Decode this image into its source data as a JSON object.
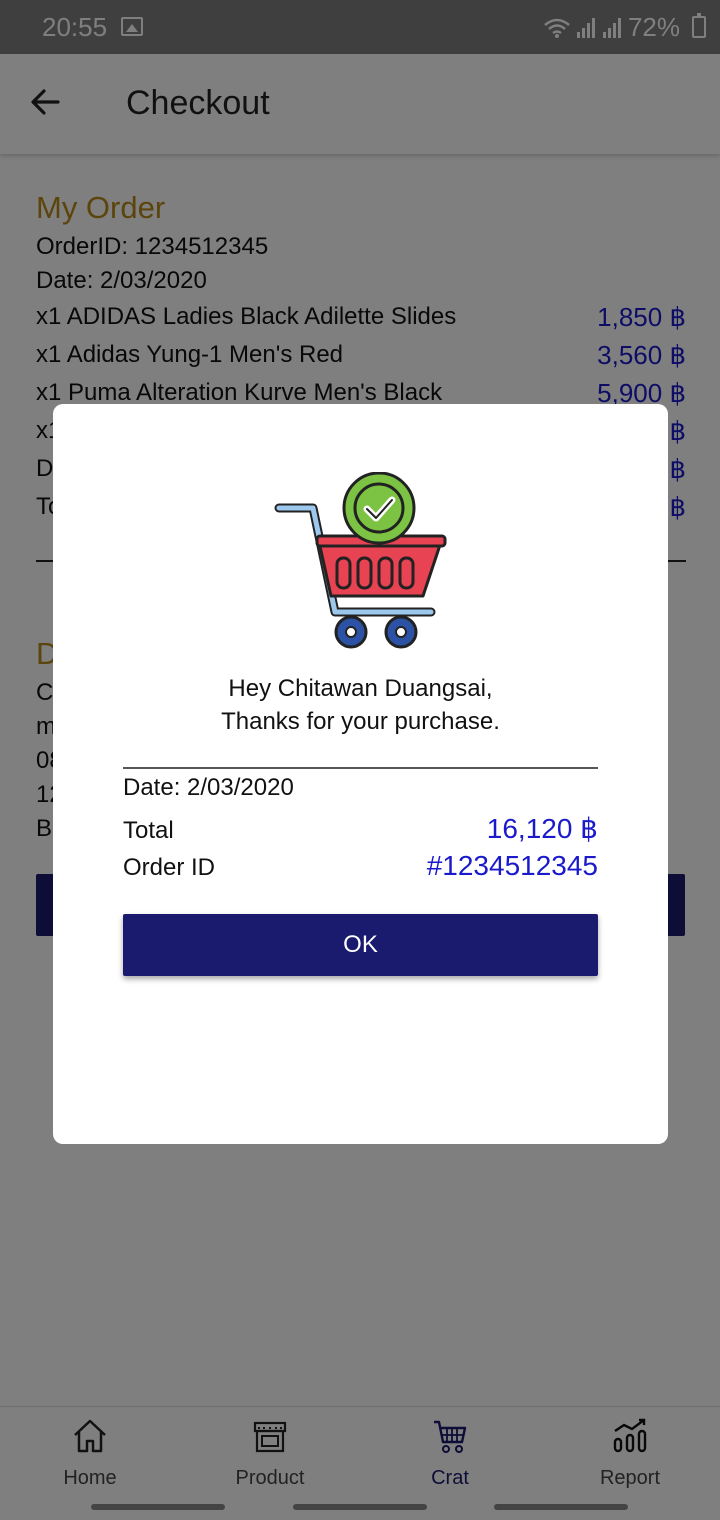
{
  "status_bar": {
    "time": "20:55",
    "battery": "72%"
  },
  "app_bar": {
    "title": "Checkout"
  },
  "order": {
    "section_title": "My Order",
    "order_id_line": "OrderID: 1234512345",
    "date_line": "Date: 2/03/2020",
    "items": [
      {
        "name": "x1 ADIDAS Ladies Black Adilette Slides",
        "price": "1,850 ฿"
      },
      {
        "name": "x1 Adidas Yung-1 Men's Red",
        "price": "3,560 ฿"
      },
      {
        "name": "x1 Puma Alteration Kurve Men's Black",
        "price": "5,900 ฿"
      },
      {
        "name": "x1",
        "price": "฿"
      },
      {
        "name": "De",
        "price": "฿"
      },
      {
        "name": "To",
        "price": "฿"
      }
    ]
  },
  "delivery": {
    "section_title": "D",
    "lines": [
      "C",
      "m",
      "08",
      "12",
      "B"
    ]
  },
  "dialog": {
    "greeting_line1": "Hey Chitawan Duangsai,",
    "greeting_line2": "Thanks for your purchase.",
    "date_line": "Date: 2/03/2020",
    "total_label": "Total",
    "total_value": "16,120 ฿",
    "order_id_label": "Order ID",
    "order_id_value": "#1234512345",
    "ok_label": "OK"
  },
  "bottom_nav": {
    "items": [
      {
        "label": "Home",
        "icon": "home-icon"
      },
      {
        "label": "Product",
        "icon": "store-icon"
      },
      {
        "label": "Crat",
        "icon": "cart-icon",
        "active": true
      },
      {
        "label": "Report",
        "icon": "chart-icon"
      }
    ]
  },
  "colors": {
    "accent": "#1a1a6e",
    "price": "#1a1acc",
    "section_title": "#b88a1b"
  }
}
